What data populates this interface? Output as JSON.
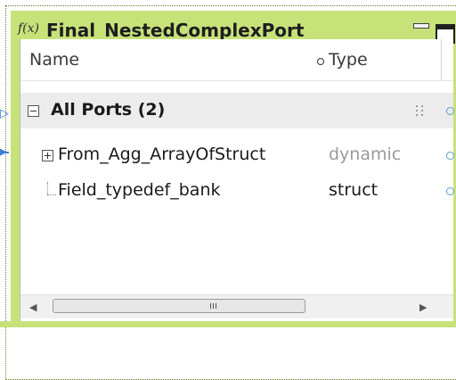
{
  "transform": {
    "icon_text": "f(x)",
    "title": "Final_NestedComplexPort"
  },
  "columns": {
    "name": "Name",
    "type": "Type"
  },
  "group": {
    "label": "All Ports (2)"
  },
  "ports": [
    {
      "name": "From_Agg_ArrayOfStruct",
      "type": "dynamic"
    },
    {
      "name": "Field_typedef_bank",
      "type": "struct"
    }
  ],
  "scrollbar": {
    "left_arrow": "◀",
    "right_arrow": "▶"
  },
  "colors": {
    "panel": "#c8e27a",
    "group_row": "#ececec",
    "port_link": "#5a9bd5"
  }
}
